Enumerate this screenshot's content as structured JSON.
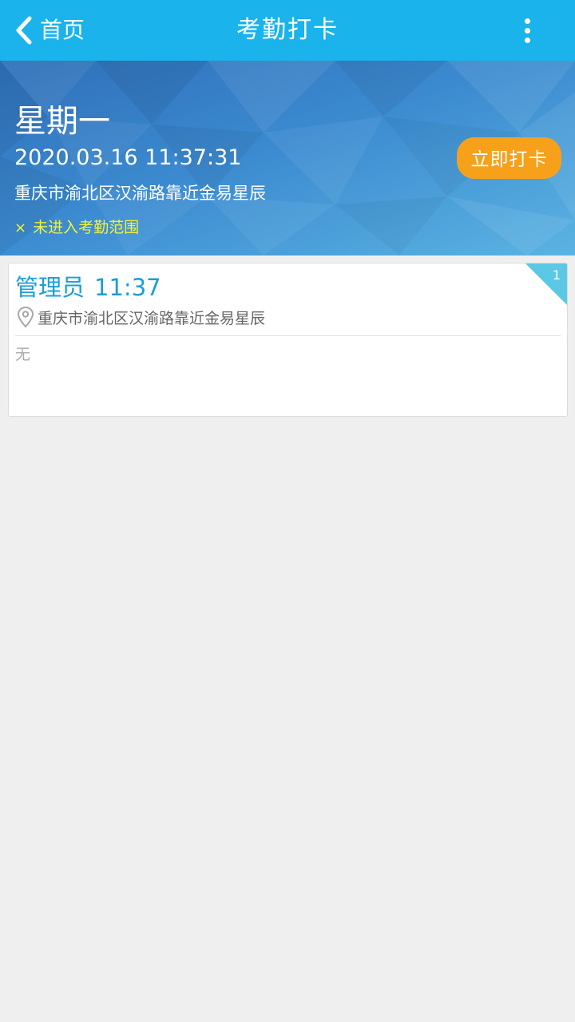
{
  "colors": {
    "nav_bar": "#1ab3ec",
    "punch_button": "#f7a11a",
    "status_warning": "#f2f23a",
    "record_title": "#1a9ed9",
    "badge": "#5bc8e6"
  },
  "navbar": {
    "back_label": "首页",
    "title": "考勤打卡",
    "back_icon": "chevron-left-icon",
    "more_icon": "more-vertical-icon"
  },
  "banner": {
    "weekday": "星期一",
    "datetime": "2020.03.16 11:37:31",
    "location": "重庆市渝北区汉渝路靠近金易星辰",
    "range_status_mark": "×",
    "range_status": "未进入考勤范围",
    "punch_button_label": "立即打卡"
  },
  "records": [
    {
      "name": "管理员",
      "time": "11:37",
      "location_icon": "map-pin-icon",
      "location": "重庆市渝北区汉渝路靠近金易星辰",
      "note": "无",
      "badge": "1"
    }
  ]
}
